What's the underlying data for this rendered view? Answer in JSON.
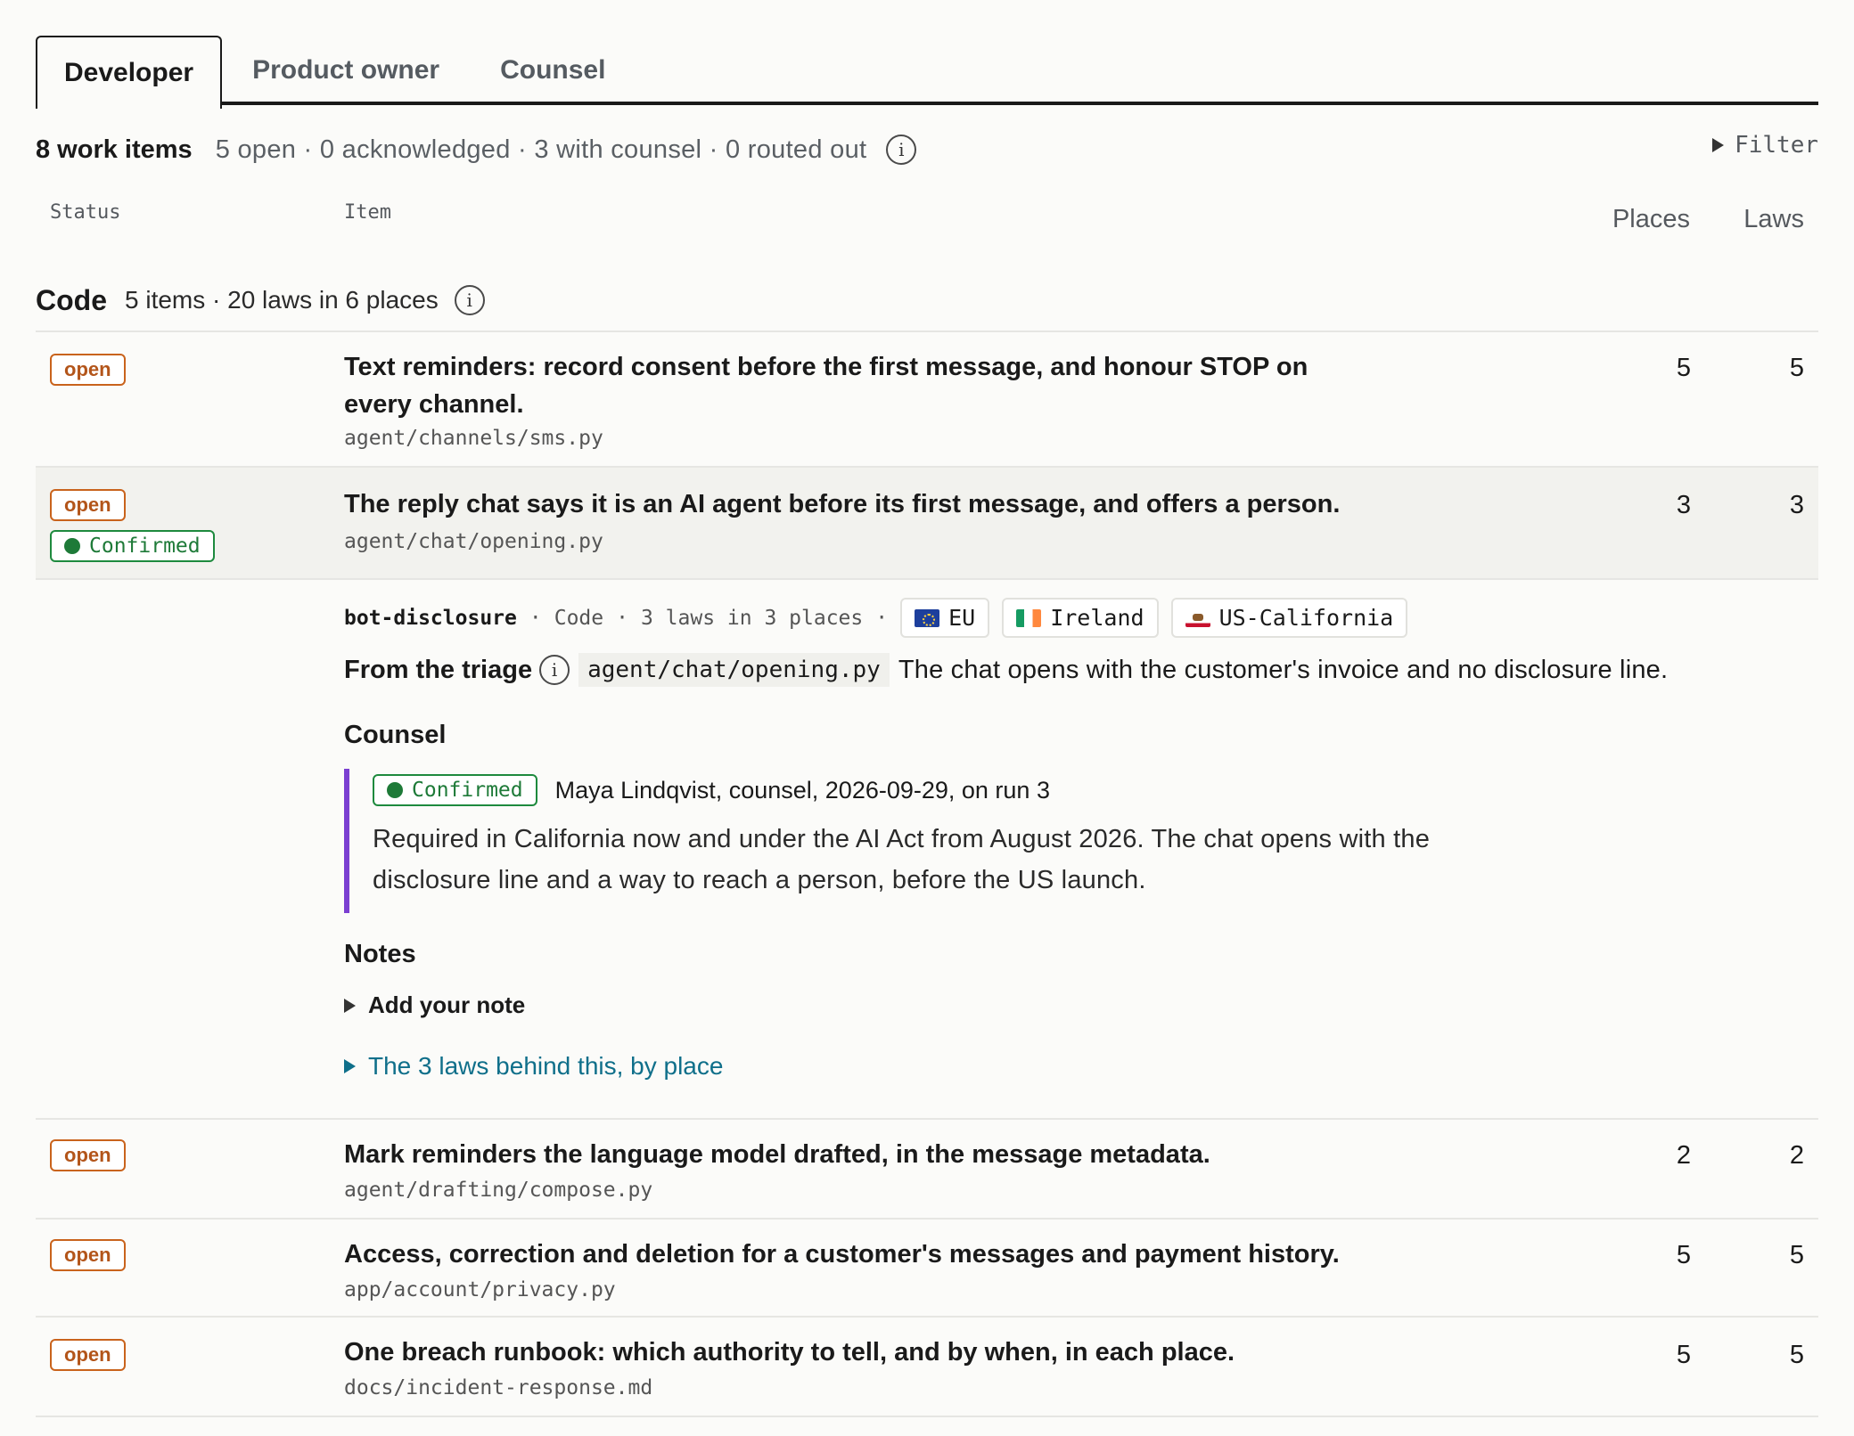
{
  "tabs": [
    {
      "label": "Developer",
      "active": true
    },
    {
      "label": "Product owner",
      "active": false
    },
    {
      "label": "Counsel",
      "active": false
    }
  ],
  "summary": {
    "count": "8 work items",
    "stats": "5 open · 0 acknowledged · 3 with counsel · 0 routed out",
    "filter": "Filter"
  },
  "columns": {
    "status": "Status",
    "item": "Item",
    "places": "Places",
    "laws": "Laws"
  },
  "group": {
    "name": "Code",
    "stats": "5 items · 20 laws in 6 places"
  },
  "rows": [
    {
      "status": "open",
      "title": "Text reminders: record consent before the first message, and honour STOP on every channel.",
      "path": "agent/channels/sms.py",
      "places": "5",
      "laws": "5"
    },
    {
      "status": "open",
      "confirmed": "Confirmed",
      "title": "The reply chat says it is an AI agent before its first message, and offers a person.",
      "path": "agent/chat/opening.py",
      "places": "3",
      "laws": "3"
    },
    {
      "status": "open",
      "title": "Mark reminders the language model drafted, in the message metadata.",
      "path": "agent/drafting/compose.py",
      "places": "2",
      "laws": "2"
    },
    {
      "status": "open",
      "title": "Access, correction and deletion for a customer's messages and payment history.",
      "path": "app/account/privacy.py",
      "places": "5",
      "laws": "5"
    },
    {
      "status": "open",
      "title": "One breach runbook: which authority to tell, and by when, in each place.",
      "path": "docs/incident-response.md",
      "places": "5",
      "laws": "5"
    }
  ],
  "detail": {
    "slug": "bot-disclosure",
    "sep": "·",
    "category": "Code",
    "laws_places": "3 laws in 3 places",
    "places": [
      {
        "flag": "eu-flag",
        "label": "EU"
      },
      {
        "flag": "ireland-flag",
        "label": "Ireland"
      },
      {
        "flag": "california-flag",
        "label": "US-California"
      }
    ],
    "triage_label": "From the triage",
    "triage_path": "agent/chat/opening.py",
    "triage_text": "The chat opens with the customer's invoice and no disclosure line.",
    "counsel_heading": "Counsel",
    "counsel_badge": "Confirmed",
    "counsel_by": "Maya Lindqvist, counsel, 2026-09-29, on run 3",
    "counsel_text": "Required in California now and under the AI Act from August 2026. The chat opens with the disclosure line and a way to reach a person, before the US launch.",
    "notes_heading": "Notes",
    "add_note": "Add your note",
    "laws_link": "The 3 laws behind this, by place"
  },
  "colors": {
    "accent_purple": "#7b3fd1",
    "open_orange": "#c9631c",
    "confirmed_green": "#1e7a38",
    "link_teal": "#0f6f8a"
  }
}
